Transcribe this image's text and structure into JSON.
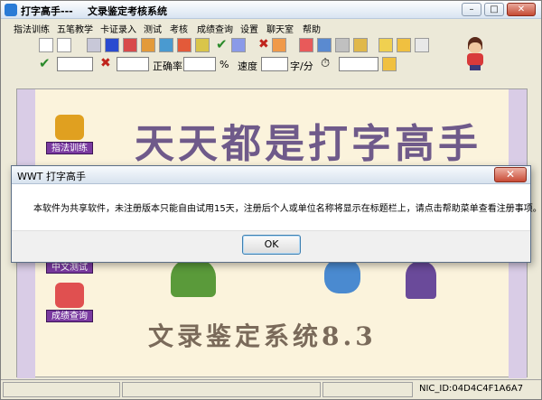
{
  "window": {
    "title": "打字高手---",
    "subtitle": "文录鉴定考核系统",
    "controls": {
      "minimize": "–",
      "maximize": "□",
      "close": "✕"
    }
  },
  "menu": [
    "指法训练",
    "五笔教学",
    "卡证录入",
    "测试",
    "考核",
    "成绩查询",
    "设置",
    "聊天室",
    "帮助"
  ],
  "toolbar2": {
    "accuracy_label": "正确率",
    "percent_label": "%",
    "speed_label": "速度",
    "speed_unit": "字/分"
  },
  "canvas": {
    "banner_text": "天天都是打字高手",
    "footer_text": "文录鉴定系统8.3",
    "side_buttons": [
      "指法训练",
      "中文测试",
      "成绩查询"
    ]
  },
  "status": {
    "nic_id": "NIC_ID:04D4C4F1A6A7"
  },
  "dialog": {
    "title": "WWT 打字高手",
    "message": "本软件为共享软件，未注册版本只能自由试用15天，注册后个人或单位名称将显示在标题栏上，请点击帮助菜单查看注册事项。",
    "ok_label": "OK",
    "close_glyph": "✕"
  },
  "colors": {
    "accent": "#7a3aa0",
    "canvas_bg": "#fbf3dc",
    "band": "#d9cce6"
  }
}
